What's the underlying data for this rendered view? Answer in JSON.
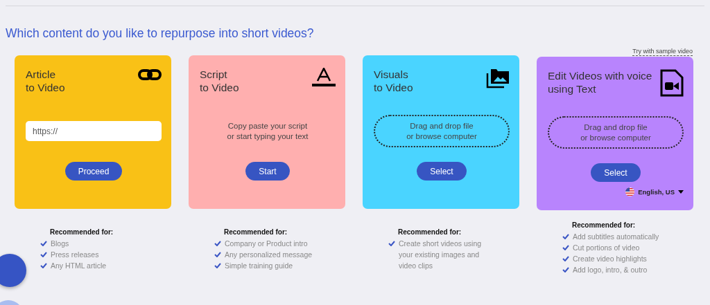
{
  "heading": "Which content do you like to repurpose into short videos?",
  "sample_link": "Try with sample video",
  "cards": [
    {
      "kind": "url",
      "title_lines": [
        "Article",
        "to Video"
      ],
      "color": "#f9c116",
      "placeholder": "https://",
      "button": "Proceed",
      "recommended_title": "Recommended for:",
      "recommended": [
        "Blogs",
        "Press releases",
        "Any HTML article"
      ]
    },
    {
      "kind": "prompt",
      "title_lines": [
        "Script",
        "to Video"
      ],
      "color": "#ffafaf",
      "prompt": "Copy paste your script\nor start typing your text",
      "button": "Start",
      "recommended_title": "Recommended for:",
      "recommended": [
        "Company or Product intro",
        "Any personalized message",
        "Simple training guide"
      ]
    },
    {
      "kind": "dropzone",
      "title_lines": [
        "Visuals",
        "to Video"
      ],
      "color": "#4ad4ff",
      "prompt": "Drag and drop file\nor browse computer",
      "button": "Select",
      "recommended_title": "Recommended for:",
      "recommended": [
        "Create short videos using your existing images and video clips"
      ]
    },
    {
      "kind": "dropzone",
      "title_lines": [
        "Edit Videos with voice",
        "using Text"
      ],
      "color": "#b884fd",
      "prompt": "Drag and drop file\nor browse computer",
      "button": "Select",
      "language": "English, US",
      "recommended_title": "Recommended for:",
      "recommended": [
        "Add subtitles automatically",
        "Cut portions of video",
        "Create video highlights",
        "Add logo, intro, & outro"
      ]
    }
  ]
}
